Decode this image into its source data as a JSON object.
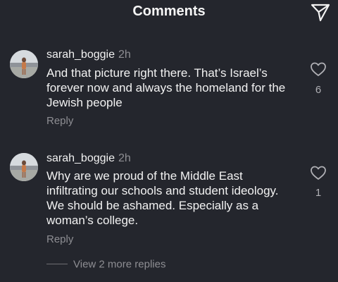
{
  "header": {
    "title": "Comments",
    "share_icon": "paper-plane-icon"
  },
  "comments": [
    {
      "username": "sarah_boggie",
      "time": "2h",
      "text": "And that picture right there. That’s Israel’s forever now and always the homeland for the Jewish people",
      "reply_label": "Reply",
      "like_count": "6",
      "like_icon": "heart-outline-icon"
    },
    {
      "username": "sarah_boggie",
      "time": "2h",
      "text": "Why are we proud of the Middle East infiltrating our schools and student ideology. We should be ashamed. Especially as a woman’s college.",
      "reply_label": "Reply",
      "like_count": "1",
      "like_icon": "heart-outline-icon"
    }
  ],
  "more_replies_label": "View 2 more replies",
  "colors": {
    "background": "#24262d",
    "text": "#f2f2f2",
    "muted": "#8e8e93"
  }
}
